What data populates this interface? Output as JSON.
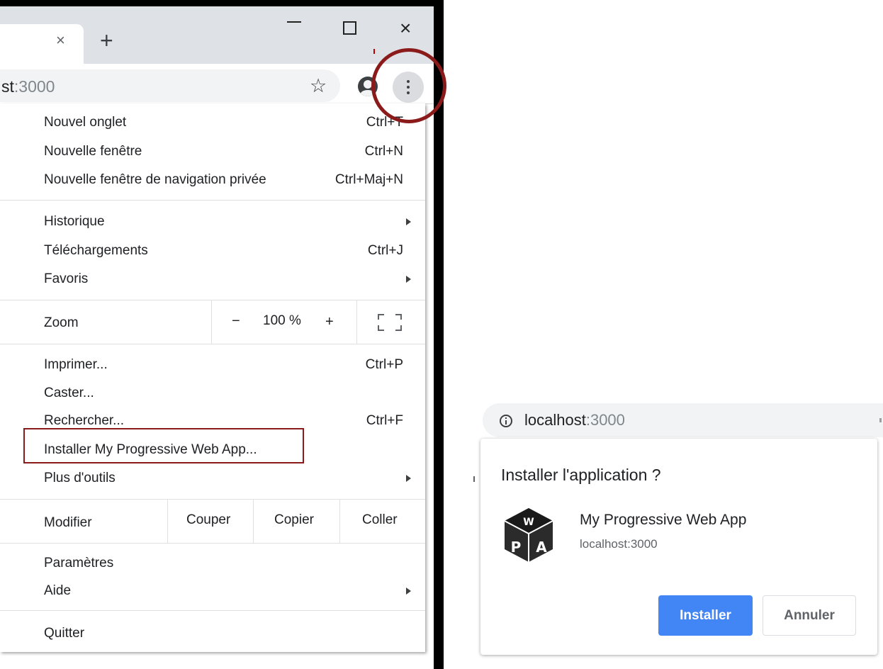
{
  "browser": {
    "tab_close": "×",
    "new_tab": "+",
    "win_close": "×",
    "address": {
      "host_partial": "st",
      "port": ":3000"
    },
    "star": "☆"
  },
  "menu": {
    "new_tab": {
      "label": "Nouvel onglet",
      "shortcut": "Ctrl+T"
    },
    "new_window": {
      "label": "Nouvelle fenêtre",
      "shortcut": "Ctrl+N"
    },
    "private_window": {
      "label": "Nouvelle fenêtre de navigation privée",
      "shortcut": "Ctrl+Maj+N"
    },
    "history": {
      "label": "Historique"
    },
    "downloads": {
      "label": "Téléchargements",
      "shortcut": "Ctrl+J"
    },
    "bookmarks": {
      "label": "Favoris"
    },
    "zoom": {
      "label": "Zoom",
      "minus": "−",
      "value": "100 %",
      "plus": "+"
    },
    "print": {
      "label": "Imprimer...",
      "shortcut": "Ctrl+P"
    },
    "cast": {
      "label": "Caster..."
    },
    "find": {
      "label": "Rechercher...",
      "shortcut": "Ctrl+F"
    },
    "install": {
      "label": "Installer My Progressive Web App..."
    },
    "more_tools": {
      "label": "Plus d'outils"
    },
    "edit": {
      "label": "Modifier",
      "cut": "Couper",
      "copy": "Copier",
      "paste": "Coller"
    },
    "settings": {
      "label": "Paramètres"
    },
    "help": {
      "label": "Aide"
    },
    "quit": {
      "label": "Quitter"
    }
  },
  "install_dialog": {
    "address": {
      "host": "localhost",
      "port": ":3000"
    },
    "title": "Installer l'application ?",
    "app_name": "My Progressive Web App",
    "app_host": "localhost:3000",
    "install_button": "Installer",
    "cancel_button": "Annuler",
    "logo_letters": [
      "W",
      "P",
      "A"
    ]
  },
  "colors": {
    "accent_blue": "#4285f4",
    "annotation_red": "#8b1a1a",
    "titlebar": "#dee1e6"
  }
}
